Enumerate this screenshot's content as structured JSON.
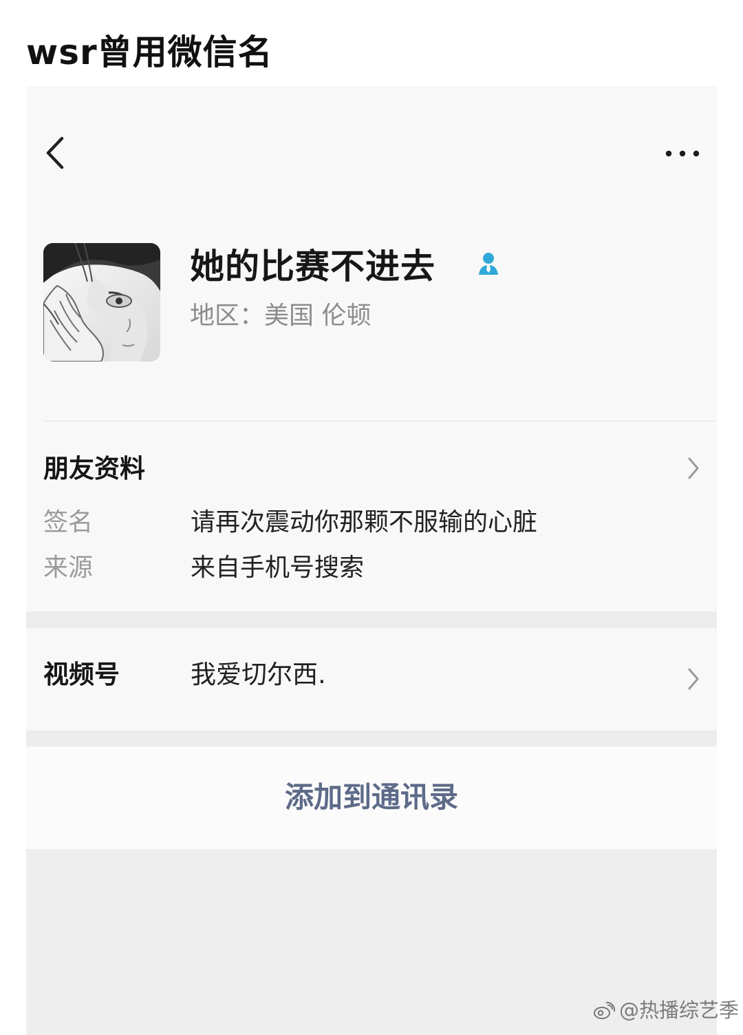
{
  "caption": {
    "text": "wsr曾用微信名"
  },
  "top_bar": {
    "back_icon": "chevron-left-icon",
    "more_icon": "more-options-icon"
  },
  "profile": {
    "avatar_icon": "avatar-image",
    "name": "她的比赛不进去",
    "verify_icon": "user-verified-icon",
    "region": "地区：美国 伦顿",
    "accent_color": "#2fa8d8"
  },
  "friend_info": {
    "title": "朋友资料",
    "chevron_icon": "chevron-right-icon",
    "rows": [
      {
        "label": "签名",
        "value": "请再次震动你那颗不服输的心脏"
      },
      {
        "label": "来源",
        "value": "来自手机号搜索"
      }
    ]
  },
  "video_channel": {
    "label": "视频号",
    "value": "我爱切尔西.",
    "chevron_icon": "chevron-right-icon"
  },
  "action": {
    "add_contact": "添加到通讯录",
    "color": "#5d6a88"
  },
  "watermark": {
    "logo_icon": "weibo-logo-icon",
    "text": "@热播综艺季"
  }
}
